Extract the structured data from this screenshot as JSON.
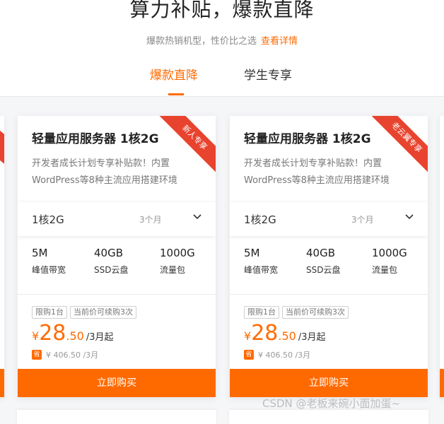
{
  "header": {
    "title": "算力补贴，爆款直降",
    "subtitle": "爆款热销机型，性价比之选",
    "subtitle_link": "查看详情"
  },
  "tabs": [
    {
      "label": "爆款直降",
      "active": true
    },
    {
      "label": "学生专享",
      "active": false
    }
  ],
  "cards": [
    {
      "name": "轻量应用服务器 1核2G",
      "badge": "新人专享",
      "desc_line1": "开发者成长计划专享补贴款！内置",
      "desc_line2": "WordPress等8种主流应用搭建环境",
      "config_value": "1核2G",
      "config_duration": "3个月",
      "specs": [
        {
          "value": "5M",
          "label": "峰值带宽"
        },
        {
          "value": "40GB",
          "label": "SSD云盘"
        },
        {
          "value": "1000G",
          "label": "流量包"
        }
      ],
      "tag_limit": "限购1台",
      "tag_renew": "当前价可续购3次",
      "price_currency": "¥",
      "price_int": "28",
      "price_dec": ".50",
      "price_unit": "/3月起",
      "save_icon_text": "省",
      "original_price": "¥ 406.50 /3月",
      "buy_label": "立即购买"
    },
    {
      "name": "轻量应用服务器 1核2G",
      "badge": "老云翼专享",
      "desc_line1": "开发者成长计划专享补贴款！内置",
      "desc_line2": "WordPress等8种主流应用搭建环境",
      "config_value": "1核2G",
      "config_duration": "3个月",
      "specs": [
        {
          "value": "5M",
          "label": "峰值带宽"
        },
        {
          "value": "40GB",
          "label": "SSD云盘"
        },
        {
          "value": "1000G",
          "label": "流量包"
        }
      ],
      "tag_limit": "限购1台",
      "tag_renew": "当前价可续购3次",
      "price_currency": "¥",
      "price_int": "28",
      "price_dec": ".50",
      "price_unit": "/3月起",
      "save_icon_text": "省",
      "original_price": "¥ 406.50 /3月",
      "buy_label": "立即购买"
    }
  ],
  "watermark": "CSDN @老板来碗小面加蛋~",
  "colors": {
    "accent": "#ff6a00",
    "ribbon": "#e8432e"
  }
}
